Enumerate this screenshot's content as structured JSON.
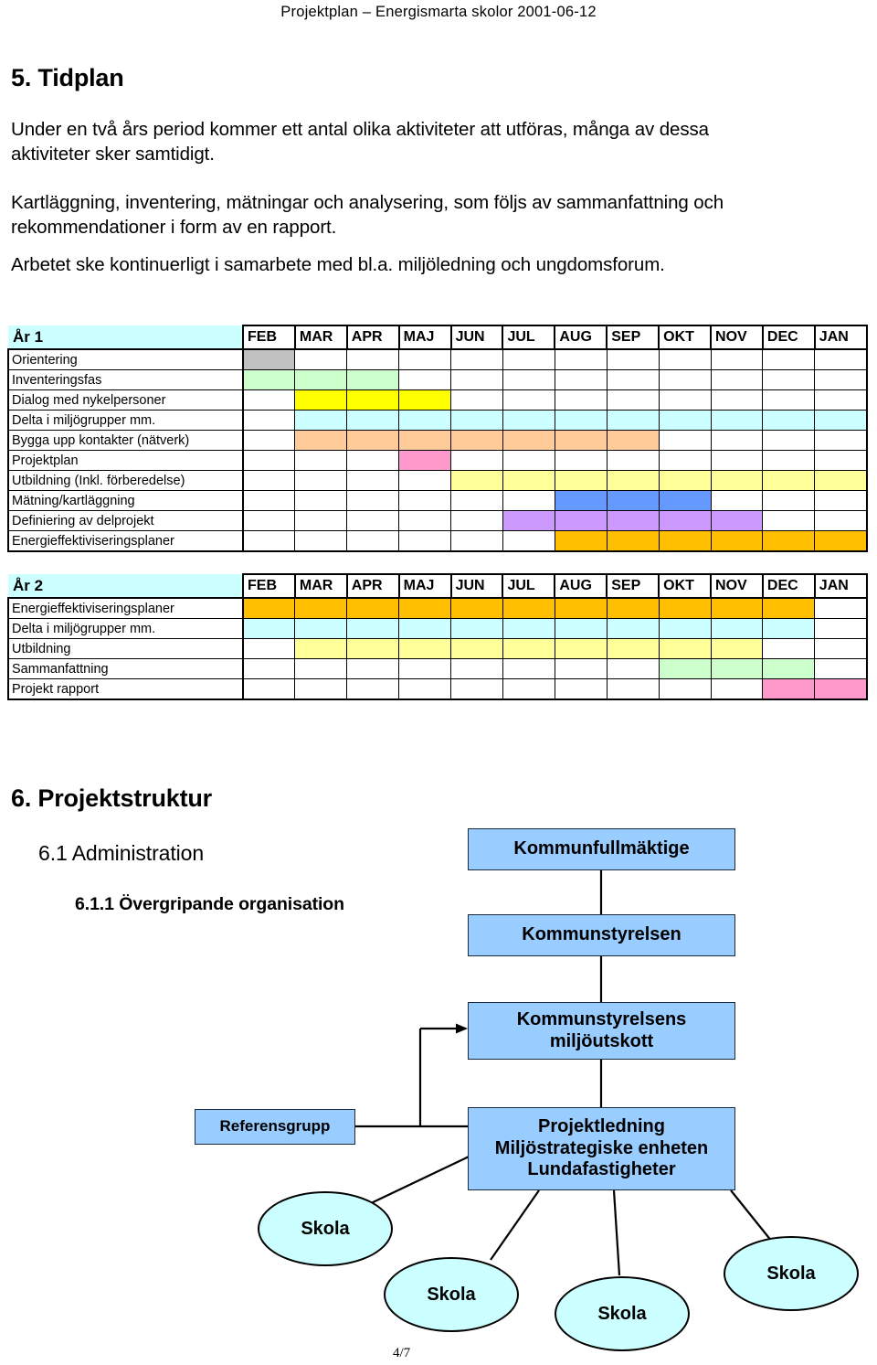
{
  "header": {
    "running_title": "Projektplan – Energismarta skolor   2001-06-12"
  },
  "sections": {
    "tidplan_heading": "5. Tidplan",
    "paragraph_1": "Under en två års period kommer ett antal olika aktiviteter att utföras, många av dessa aktiviteter sker samtidigt.",
    "paragraph_2": "Kartläggning, inventering, mätningar och analysering, som följs av sammanfattning och rekommendationer i form av en rapport.",
    "paragraph_3": "Arbetet ske kontinuerligt i samarbete med bl.a. miljöledning och ungdomsforum.",
    "projektstruktur_heading": "6. Projektstruktur",
    "administration_heading": "6.1 Administration",
    "overgripande_heading": "6.1.1 Övergripande organisation"
  },
  "chart_data": [
    {
      "type": "table",
      "title": "År 1",
      "categories": [
        "FEB",
        "MAR",
        "APR",
        "MAJ",
        "JUN",
        "JUL",
        "AUG",
        "SEP",
        "OKT",
        "NOV",
        "DEC",
        "JAN"
      ],
      "rows": [
        {
          "label": "Orientering",
          "color": "#C0C0C0",
          "cells": [
            1,
            0,
            0,
            0,
            0,
            0,
            0,
            0,
            0,
            0,
            0,
            0
          ]
        },
        {
          "label": "Inventeringsfas",
          "color": "#CCFFCC",
          "cells": [
            1,
            1,
            1,
            0,
            0,
            0,
            0,
            0,
            0,
            0,
            0,
            0
          ]
        },
        {
          "label": "Dialog med nykelpersoner",
          "color": "#FFFF00",
          "cells": [
            0,
            1,
            1,
            1,
            0,
            0,
            0,
            0,
            0,
            0,
            0,
            0
          ]
        },
        {
          "label": "Delta i miljögrupper mm.",
          "color": "#CCFFFF",
          "cells": [
            0,
            1,
            1,
            1,
            1,
            1,
            1,
            1,
            1,
            1,
            1,
            1
          ]
        },
        {
          "label": "Bygga upp kontakter (nätverk)",
          "color": "#FFCC99",
          "cells": [
            0,
            1,
            1,
            1,
            1,
            1,
            1,
            1,
            0,
            0,
            0,
            0
          ]
        },
        {
          "label": "Projektplan",
          "color": "#FF99CC",
          "cells": [
            0,
            0,
            0,
            1,
            0,
            0,
            0,
            0,
            0,
            0,
            0,
            0
          ]
        },
        {
          "label": "Utbildning (Inkl. förberedelse)",
          "color": "#FFFF99",
          "cells": [
            0,
            0,
            0,
            0,
            1,
            1,
            1,
            1,
            1,
            1,
            1,
            1
          ]
        },
        {
          "label": "Mätning/kartläggning",
          "color": "#6699FF",
          "cells": [
            0,
            0,
            0,
            0,
            0,
            0,
            1,
            1,
            1,
            0,
            0,
            0
          ]
        },
        {
          "label": "Definiering av delprojekt",
          "color": "#CC99FF",
          "cells": [
            0,
            0,
            0,
            0,
            0,
            1,
            1,
            1,
            1,
            1,
            0,
            0
          ]
        },
        {
          "label": "Energieffektiviseringsplaner",
          "color": "#FFBF00",
          "cells": [
            0,
            0,
            0,
            0,
            0,
            0,
            1,
            1,
            1,
            1,
            1,
            1
          ]
        }
      ]
    },
    {
      "type": "table",
      "title": "År 2",
      "categories": [
        "FEB",
        "MAR",
        "APR",
        "MAJ",
        "JUN",
        "JUL",
        "AUG",
        "SEP",
        "OKT",
        "NOV",
        "DEC",
        "JAN"
      ],
      "rows": [
        {
          "label": "Energieffektiviseringsplaner",
          "color": "#FFBF00",
          "cells": [
            1,
            1,
            1,
            1,
            1,
            1,
            1,
            1,
            1,
            1,
            1,
            0
          ]
        },
        {
          "label": "Delta i miljögrupper mm.",
          "color": "#CCFFFF",
          "cells": [
            1,
            1,
            1,
            1,
            1,
            1,
            1,
            1,
            1,
            1,
            1,
            0
          ]
        },
        {
          "label": "Utbildning",
          "color": "#FFFF99",
          "cells": [
            0,
            1,
            1,
            1,
            1,
            1,
            1,
            1,
            1,
            1,
            0,
            0
          ]
        },
        {
          "label": "Sammanfattning",
          "color": "#CCFFCC",
          "cells": [
            0,
            0,
            0,
            0,
            0,
            0,
            0,
            0,
            1,
            1,
            1,
            0
          ]
        },
        {
          "label": "Projekt rapport",
          "color": "#FF99CC",
          "cells": [
            0,
            0,
            0,
            0,
            0,
            0,
            0,
            0,
            0,
            0,
            1,
            1
          ]
        }
      ]
    }
  ],
  "org_chart": {
    "boxes": {
      "kommunfullmaktige": "Kommunfullmäktige",
      "kommunstyrelsen": "Kommunstyrelsen",
      "miljoutskott_line1": "Kommunstyrelsens",
      "miljoutskott_line2": "miljöutskott",
      "referensgrupp": "Referensgrupp",
      "projektledning_line1": "Projektledning",
      "projektledning_line2": "Miljöstrategiske enheten",
      "projektledning_line3": "Lundafastigheter"
    },
    "schools": [
      "Skola",
      "Skola",
      "Skola",
      "Skola"
    ],
    "colors": {
      "box_fill": "#99CCFF",
      "ellipse_fill": "#CCFFFF",
      "line": "#000000"
    }
  },
  "footer": {
    "page": "4/7"
  }
}
